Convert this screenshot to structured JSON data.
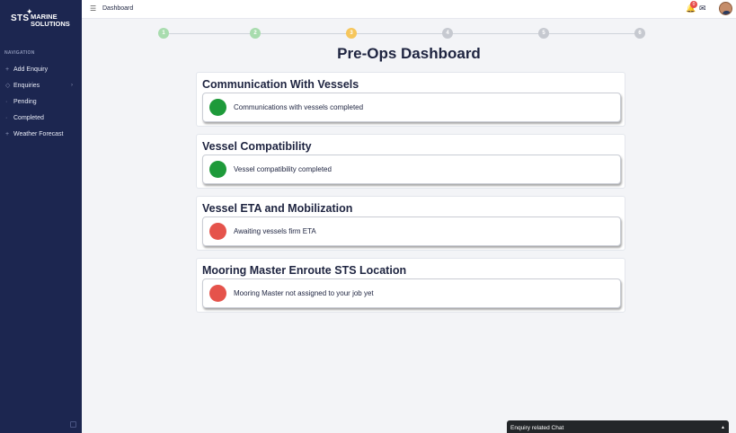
{
  "brand": {
    "short": "STS",
    "name_line1": "MARINE",
    "name_line2": "SOLUTIONS"
  },
  "sidebar": {
    "nav_title": "NAVIGATION",
    "items": [
      {
        "label": "Add Enquiry",
        "icon": "plus-icon"
      },
      {
        "label": "Enquiries",
        "icon": "tag-icon",
        "expandable": true
      },
      {
        "label": "Pending",
        "icon": "dot-icon"
      },
      {
        "label": "Completed",
        "icon": "dot-icon"
      },
      {
        "label": "Weather Forecast",
        "icon": "plus-icon"
      }
    ]
  },
  "topbar": {
    "breadcrumb": "Dashboard",
    "notification_count": "0"
  },
  "stepper": {
    "steps": [
      {
        "label": "1",
        "color": "#a8dcae"
      },
      {
        "label": "2",
        "color": "#a8dcae"
      },
      {
        "label": "3",
        "color": "#f6c65c"
      },
      {
        "label": "4",
        "color": "#c6c9d0"
      },
      {
        "label": "5",
        "color": "#c6c9d0"
      },
      {
        "label": "6",
        "color": "#c6c9d0"
      }
    ]
  },
  "page_title": "Pre-Ops Dashboard",
  "cards": [
    {
      "title": "Communication With Vessels",
      "status": "Communications with vessels completed",
      "color": "#1e9a3a"
    },
    {
      "title": "Vessel Compatibility",
      "status": "Vessel compatibility completed",
      "color": "#1e9a3a"
    },
    {
      "title": "Vessel ETA and Mobilization",
      "status": "Awaiting vessels firm ETA",
      "color": "#e5534b"
    },
    {
      "title": "Mooring Master Enroute STS Location",
      "status": "Mooring Master not assigned to your job yet",
      "color": "#e5534b"
    }
  ],
  "chat": {
    "label": "Enquiry related Chat"
  }
}
